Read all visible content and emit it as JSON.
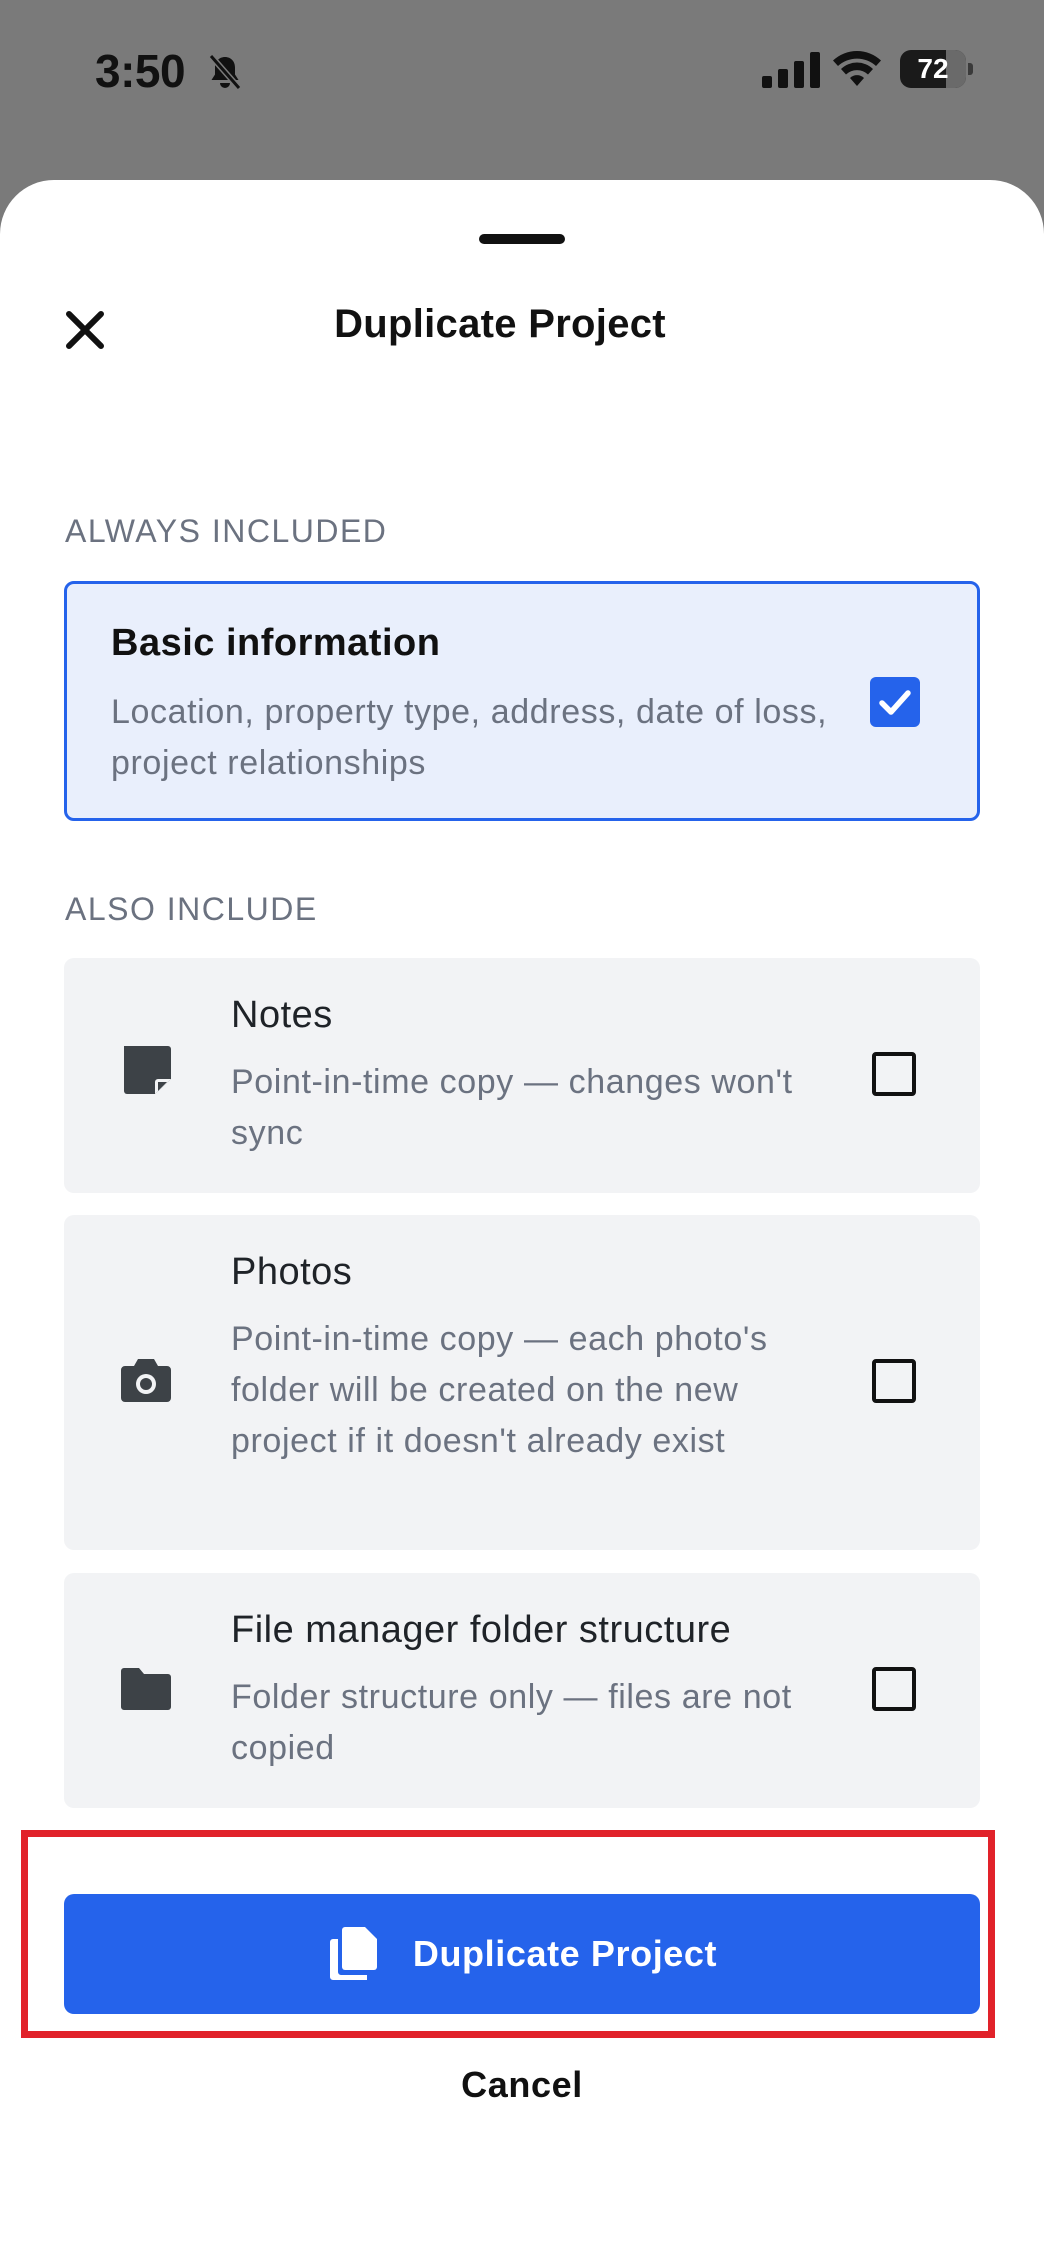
{
  "status_bar": {
    "time": "3:50",
    "battery_level": "72",
    "icons": [
      "bell-slash-icon",
      "cellular-signal-icon",
      "wifi-icon",
      "battery-icon"
    ]
  },
  "sheet": {
    "title": "Duplicate Project",
    "close_icon": "close-icon"
  },
  "always_included": {
    "label": "ALWAYS INCLUDED",
    "item": {
      "title": "Basic information",
      "description": "Location, property type, address, date of loss, project relationships",
      "checked": true
    }
  },
  "also_include": {
    "label": "ALSO INCLUDE",
    "items": [
      {
        "title": "Notes",
        "description": "Point-in-time copy — changes won't sync",
        "icon": "note-icon",
        "checked": false
      },
      {
        "title": "Photos",
        "description": "Point-in-time copy — each photo's folder will be created on the new project if it doesn't already exist",
        "icon": "camera-icon",
        "checked": false
      },
      {
        "title": "File manager folder structure",
        "description": "Folder structure only — files are not copied",
        "icon": "folder-icon",
        "checked": false
      }
    ]
  },
  "actions": {
    "primary_label": "Duplicate Project",
    "primary_icon": "copy-icon",
    "cancel_label": "Cancel"
  },
  "colors": {
    "accent": "#2563eb",
    "highlight": "#e1222a",
    "card_bg": "#f2f3f5",
    "selected_bg": "#e9effc"
  }
}
